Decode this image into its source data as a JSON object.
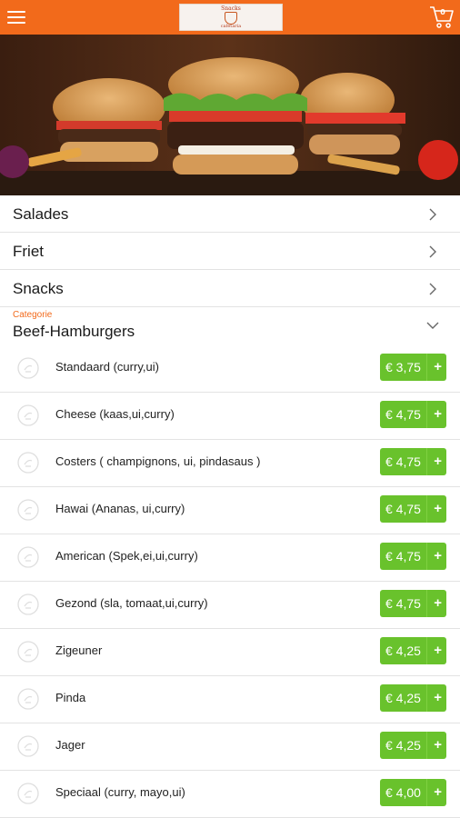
{
  "header": {
    "logo_top": "Snacks",
    "logo_bottom": "cafetaria",
    "cart_count": "0",
    "menu_icon": "hamburger-menu-icon",
    "cart_icon": "shopping-cart-icon",
    "brand_color": "#f26a1b"
  },
  "categories": [
    {
      "label": "Salades"
    },
    {
      "label": "Friet"
    },
    {
      "label": "Snacks"
    }
  ],
  "open_category": {
    "small_label": "Categorie",
    "title": "Beef-Hamburgers"
  },
  "products": [
    {
      "name": "Standaard (curry,ui)",
      "price": "€ 3,75",
      "add": "+"
    },
    {
      "name": "Cheese (kaas,ui,curry)",
      "price": "€ 4,75",
      "add": "+"
    },
    {
      "name": "Costers ( champignons, ui, pindasaus )",
      "price": "€ 4,75",
      "add": "+"
    },
    {
      "name": "Hawai (Ananas, ui,curry)",
      "price": "€ 4,75",
      "add": "+"
    },
    {
      "name": "American (Spek,ei,ui,curry)",
      "price": "€ 4,75",
      "add": "+"
    },
    {
      "name": "Gezond (sla, tomaat,ui,curry)",
      "price": "€ 4,75",
      "add": "+"
    },
    {
      "name": "Zigeuner",
      "price": "€ 4,25",
      "add": "+"
    },
    {
      "name": "Pinda",
      "price": "€ 4,25",
      "add": "+"
    },
    {
      "name": "Jager",
      "price": "€ 4,25",
      "add": "+"
    },
    {
      "name": "Speciaal (curry, mayo,ui)",
      "price": "€ 4,00",
      "add": "+"
    }
  ],
  "colors": {
    "price_button": "#69c22c",
    "category_small": "#f26a1b"
  }
}
